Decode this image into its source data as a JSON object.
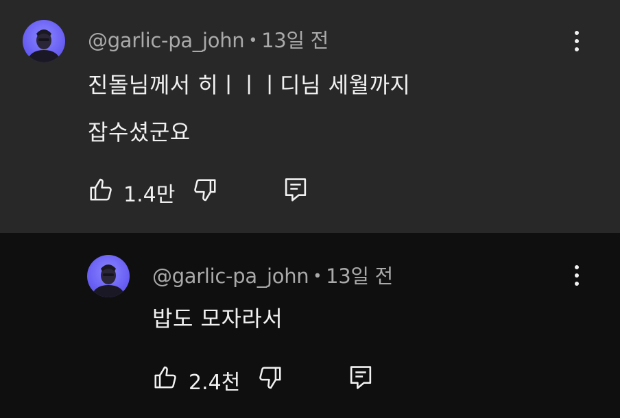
{
  "comments": [
    {
      "author": "@garlic-pa_john",
      "separator": "•",
      "time": "13일 전",
      "lines": [
        "진돌님께서 히ㅣㅣㅣ디님 세월까지",
        "잡수셨군요"
      ],
      "like_count": "1.4만"
    },
    {
      "author": "@garlic-pa_john",
      "separator": "•",
      "time": "13일 전",
      "lines": [
        "밥도 모자라서"
      ],
      "like_count": "2.4천"
    }
  ],
  "icons": {
    "more": "more-vertical-icon",
    "like": "thumb-up-icon",
    "dislike": "thumb-down-icon",
    "reply": "reply-comment-icon"
  },
  "colors": {
    "top_comment_bg": "#282828",
    "reply_bg": "#0f0f0f",
    "text_primary": "#f1f1f1",
    "text_secondary": "#aaaaaa",
    "avatar_bg": "#6c63f5"
  }
}
